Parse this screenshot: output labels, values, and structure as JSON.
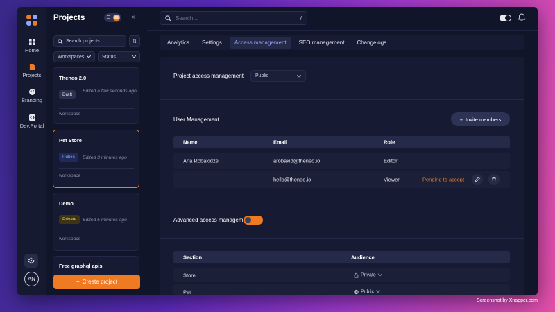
{
  "rail": {
    "items": [
      {
        "label": "Home"
      },
      {
        "label": "Projects"
      },
      {
        "label": "Branding"
      },
      {
        "label": "Dev.Portal"
      }
    ],
    "avatar": "AN"
  },
  "projects_panel": {
    "title": "Projects",
    "toggle_a": "☰",
    "toggle_b": "▦",
    "collapse": "«",
    "search_placeholder": "Search projects",
    "sort_icon": "⇅",
    "filter_workspaces": "Workspaces",
    "filter_status": "Status",
    "cards": [
      {
        "name": "Theneo 2.0",
        "badge": "Draft",
        "edited": "Edited a few seconds ago",
        "workspace": "workspace"
      },
      {
        "name": "Pet Store",
        "badge": "Public",
        "edited": "Edited 3 minutes ago",
        "workspace": "workspace"
      },
      {
        "name": "Demo",
        "badge": "Private",
        "edited": "Edited 5 minutes ago",
        "workspace": "workspace"
      },
      {
        "name": "Free graphql apis"
      }
    ],
    "create_button": "Create project",
    "create_plus": "+"
  },
  "topbar": {
    "search_placeholder": "Search...",
    "search_shortcut": "/"
  },
  "tabs": [
    "Analytics",
    "Settings",
    "Access management",
    "SEO management",
    "Changelogs"
  ],
  "access": {
    "project_access_label": "Project access management",
    "project_access_value": "Public",
    "user_management_title": "User Management",
    "invite_button": "Invite members",
    "invite_plus": "+",
    "user_table": {
      "headers": [
        "Name",
        "Email",
        "Role"
      ],
      "rows": [
        {
          "name": "Ana Robakidze",
          "email": "arobakid@theneo.io",
          "role": "Editor",
          "status": ""
        },
        {
          "name": "",
          "email": "hello@theneo.io",
          "role": "Viewer",
          "status": "Pending to accept"
        }
      ]
    },
    "advanced_label": "Advanced access management",
    "advanced_enabled": true,
    "section_table": {
      "headers": [
        "Section",
        "Audience"
      ],
      "rows": [
        {
          "section": "Store",
          "audience": "Private"
        },
        {
          "section": "Pet",
          "audience": "Public"
        }
      ]
    }
  },
  "watermark": "Screenshot by Xnapper.com",
  "colors": {
    "accent": "#f07a22",
    "tab_active": "#8fa6ff",
    "background": "#11152a"
  }
}
